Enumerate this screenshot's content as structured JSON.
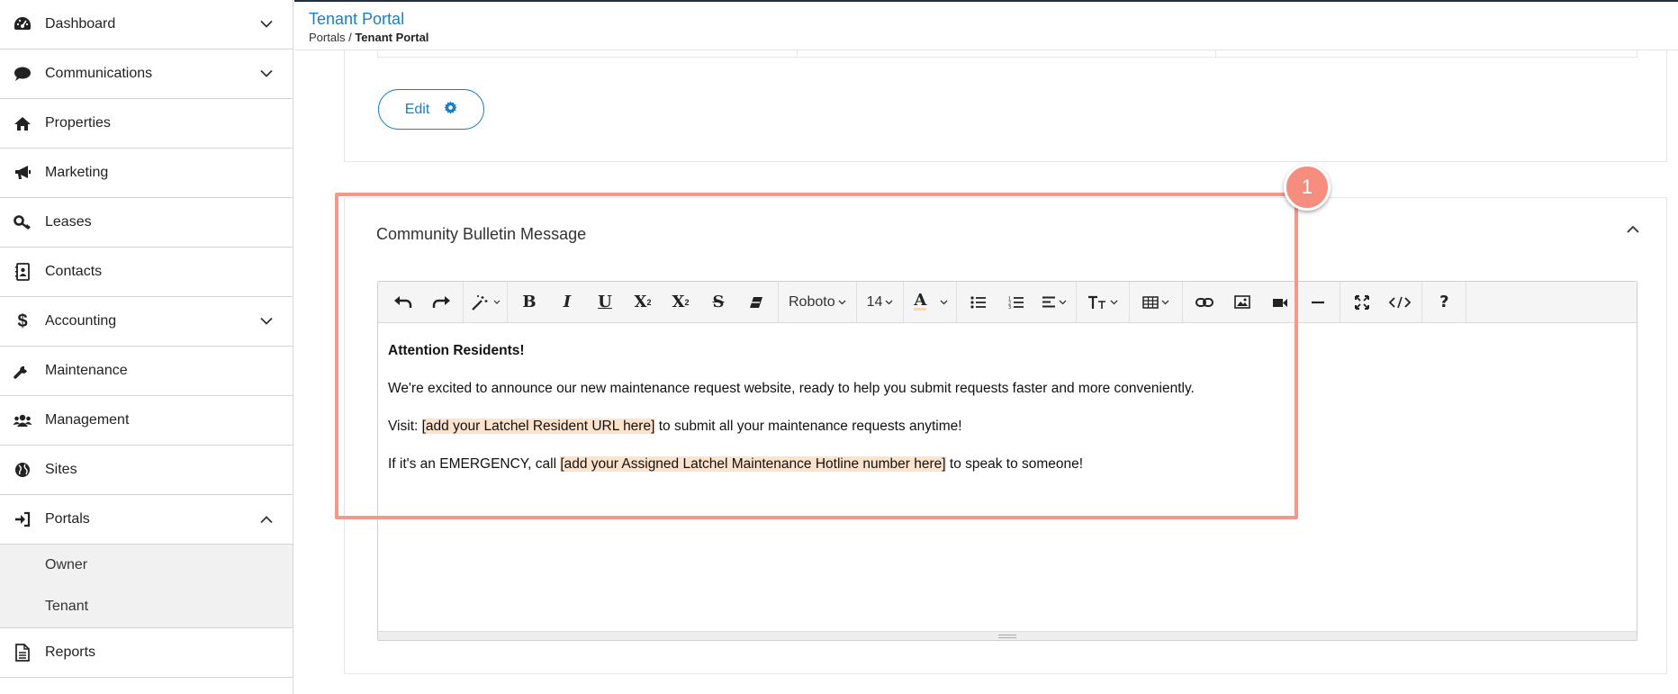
{
  "sidebar": {
    "items": [
      {
        "label": "Dashboard",
        "icon": "dashboard-icon"
      },
      {
        "label": "Communications",
        "icon": "chat-bubble-icon"
      },
      {
        "label": "Properties",
        "icon": "home-icon"
      },
      {
        "label": "Marketing",
        "icon": "megaphone-icon"
      },
      {
        "label": "Leases",
        "icon": "key-icon"
      },
      {
        "label": "Contacts",
        "icon": "address-book-icon"
      },
      {
        "label": "Accounting",
        "icon": "dollar-icon"
      },
      {
        "label": "Maintenance",
        "icon": "wrench-icon"
      },
      {
        "label": "Management",
        "icon": "users-icon"
      },
      {
        "label": "Sites",
        "icon": "globe-icon"
      },
      {
        "label": "Portals",
        "icon": "sign-in-icon"
      },
      {
        "label": "Reports",
        "icon": "document-icon"
      }
    ],
    "portals_sub": [
      {
        "label": "Owner"
      },
      {
        "label": "Tenant"
      }
    ]
  },
  "header": {
    "title": "Tenant Portal",
    "breadcrumb_parent": "Portals",
    "breadcrumb_sep": " / ",
    "breadcrumb_current": "Tenant Portal"
  },
  "settings_card": {
    "edit_label": "Edit"
  },
  "bulletin": {
    "title": "Community Bulletin Message",
    "toolbar": {
      "font_family": "Roboto",
      "font_size": "14",
      "text_color_glyph": "A",
      "help_glyph": "?"
    },
    "content": {
      "heading": "Attention Residents!",
      "para1": "We're excited to announce our new maintenance request website, ready to help you submit requests faster and more conveniently.",
      "para2_prefix": "Visit: ",
      "para2_highlight": "[add your Latchel Resident URL here]",
      "para2_suffix": " to submit all your maintenance requests anytime!",
      "para3_prefix": "If it's an EMERGENCY, call ",
      "para3_highlight": "[add your Assigned Latchel Maintenance Hotline number here]",
      "para3_suffix": " to speak to someone!"
    },
    "highlight_color": "#fde2cc"
  },
  "annotation": {
    "badge": "1",
    "color": "#f3998b"
  },
  "colors": {
    "accent": "#1a7fc4",
    "annotation": "#f3998b"
  }
}
